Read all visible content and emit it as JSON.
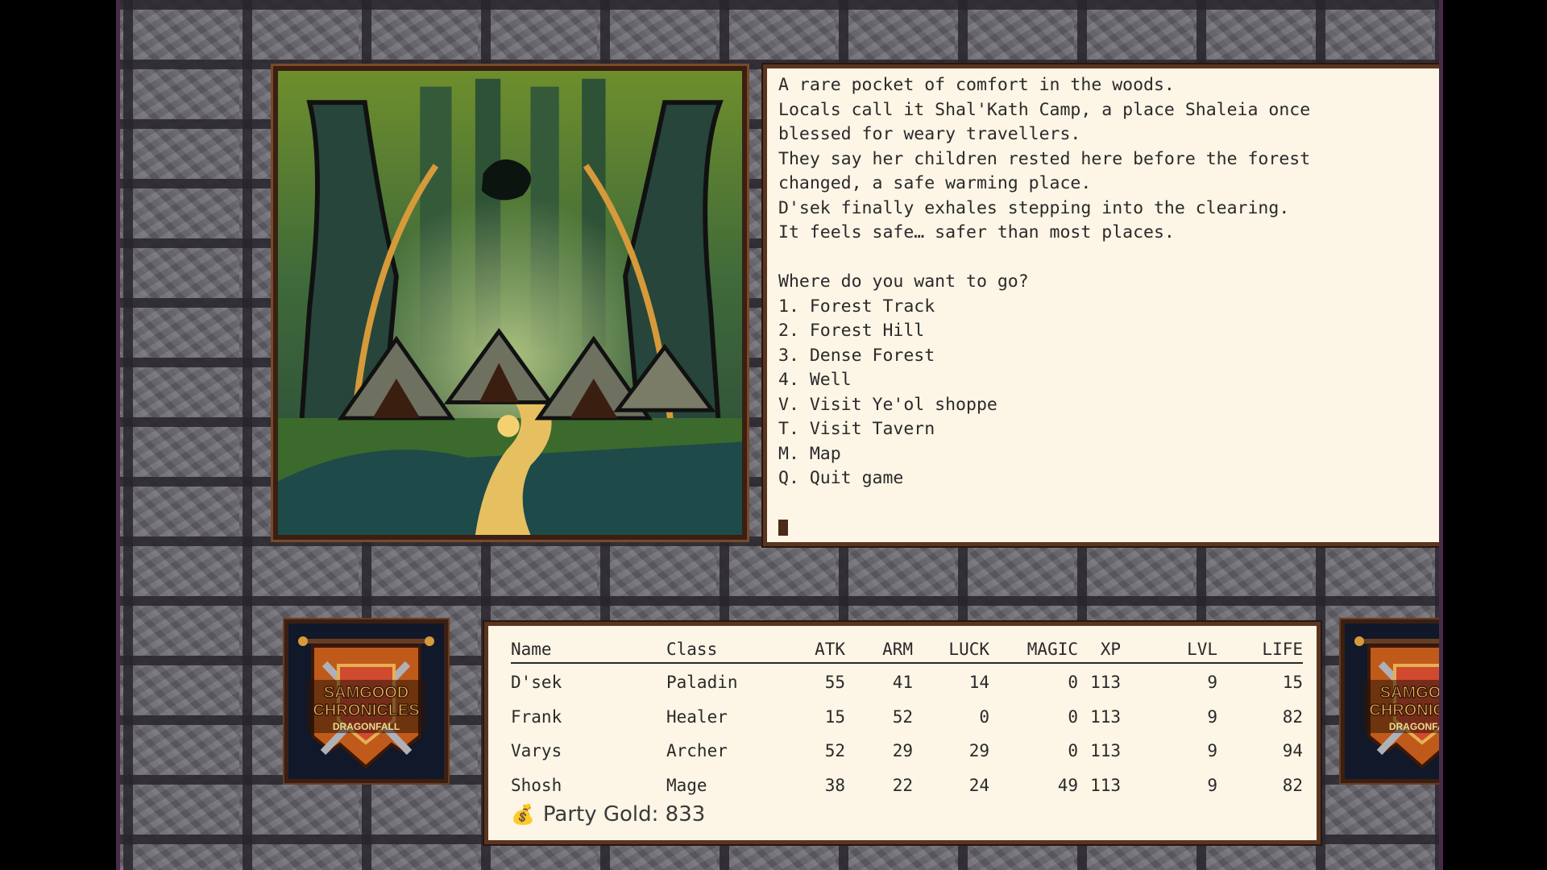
{
  "narration": [
    "A rare pocket of comfort in the woods.",
    "Locals call it Shal'Kath Camp, a place Shaleia once",
    "blessed for weary travellers.",
    "They say her children rested here before the forest",
    "changed, a safe warming place.",
    "D'sek finally exhales stepping into the clearing.",
    "It feels safe… safer than most places."
  ],
  "menu": {
    "prompt": "Where do you want to go?",
    "options": [
      {
        "key": "1.",
        "label": "Forest Track"
      },
      {
        "key": "2.",
        "label": "Forest Hill"
      },
      {
        "key": "3.",
        "label": "Dense Forest"
      },
      {
        "key": "4.",
        "label": "Well"
      },
      {
        "key": "V.",
        "label": "Visit Ye'ol shoppe"
      },
      {
        "key": "T.",
        "label": "Visit Tavern"
      },
      {
        "key": "M.",
        "label": "Map"
      },
      {
        "key": "Q.",
        "label": "Quit game"
      }
    ]
  },
  "crest": {
    "line1": "SAMGOOD",
    "line2": "CHRONICLES",
    "line3": "DRAGONFALL"
  },
  "party": {
    "headers": [
      "Name",
      "Class",
      "ATK",
      "ARM",
      "LUCK",
      "MAGIC",
      "XP",
      "LVL",
      "LIFE"
    ],
    "members": [
      {
        "name": "D'sek",
        "class": "Paladin",
        "atk": "55",
        "arm": "41",
        "luck": "14",
        "magic": "0",
        "xp": "113",
        "lvl": "9",
        "life": "15"
      },
      {
        "name": "Frank",
        "class": "Healer",
        "atk": "15",
        "arm": "52",
        "luck": "0",
        "magic": "0",
        "xp": "113",
        "lvl": "9",
        "life": "82"
      },
      {
        "name": "Varys",
        "class": "Archer",
        "atk": "52",
        "arm": "29",
        "luck": "29",
        "magic": "0",
        "xp": "113",
        "lvl": "9",
        "life": "94"
      },
      {
        "name": "Shosh",
        "class": "Mage",
        "atk": "38",
        "arm": "22",
        "luck": "24",
        "magic": "49",
        "xp": "113",
        "lvl": "9",
        "life": "82"
      }
    ],
    "gold_label": "Party Gold: 833",
    "gold_icon": "money-bag-icon"
  }
}
